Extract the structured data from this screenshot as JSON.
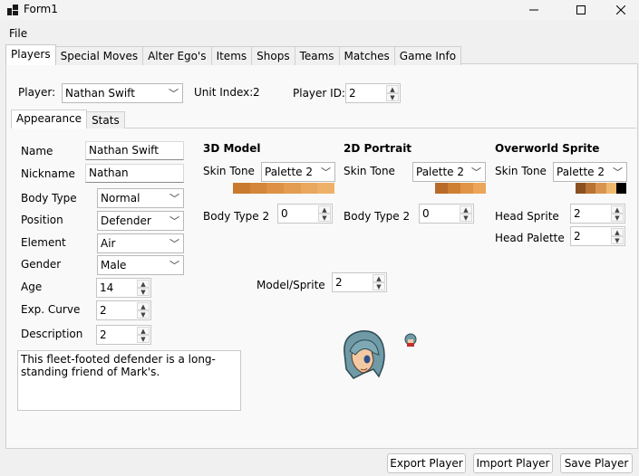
{
  "window": {
    "title": "Form1",
    "min_icon": "minimize-icon",
    "max_icon": "maximize-icon",
    "close_icon": "close-icon"
  },
  "menu": {
    "file": "File"
  },
  "tabs": [
    "Players",
    "Special Moves",
    "Alter Ego's",
    "Items",
    "Shops",
    "Teams",
    "Matches",
    "Game Info"
  ],
  "player_bar": {
    "player_label": "Player:",
    "player_value": "Nathan Swift",
    "unit_index_label": "Unit Index:",
    "unit_index_value": "2",
    "player_id_label": "Player ID:",
    "player_id_value": "2"
  },
  "subtabs": [
    "Appearance",
    "Stats"
  ],
  "appearance": {
    "name_label": "Name",
    "name_value": "Nathan Swift",
    "nickname_label": "Nickname",
    "nickname_value": "Nathan",
    "body_type_label": "Body Type",
    "body_type_value": "Normal",
    "position_label": "Position",
    "position_value": "Defender",
    "element_label": "Element",
    "element_value": "Air",
    "gender_label": "Gender",
    "gender_value": "Male",
    "age_label": "Age",
    "age_value": "14",
    "exp_curve_label": "Exp. Curve",
    "exp_curve_value": "2",
    "description_label": "Description",
    "description_value": "2",
    "description_text": "This fleet-footed defender is a long-standing friend of Mark's."
  },
  "model3d": {
    "heading": "3D Model",
    "skin_tone_label": "Skin Tone",
    "skin_tone_value": "Palette 2",
    "body_type2_label": "Body Type 2",
    "body_type2_value": "0",
    "palette": [
      "#c97a2e",
      "#d4863a",
      "#dd9146",
      "#e49c52",
      "#eaa75e",
      "#efb16a"
    ]
  },
  "portrait2d": {
    "heading": "2D Portrait",
    "skin_tone_label": "Skin Tone",
    "skin_tone_value": "Palette 2",
    "body_type2_label": "Body Type 2",
    "body_type2_value": "0",
    "palette": [
      "#b86a28",
      "#cf7f34",
      "#e19446",
      "#eda559"
    ]
  },
  "overworld": {
    "heading": "Overworld Sprite",
    "skin_tone_label": "Skin Tone",
    "skin_tone_value": "Palette 2",
    "head_sprite_label": "Head Sprite",
    "head_sprite_value": "2",
    "head_palette_label": "Head Palette",
    "head_palette_value": "2",
    "palette": [
      "#8a5120",
      "#b87234",
      "#d9954f",
      "#efb86e",
      "#000000"
    ]
  },
  "model_sprite": {
    "label": "Model/Sprite",
    "value": "2"
  },
  "buttons": {
    "export": "Export Player",
    "import": "Import Player",
    "save": "Save Player"
  }
}
